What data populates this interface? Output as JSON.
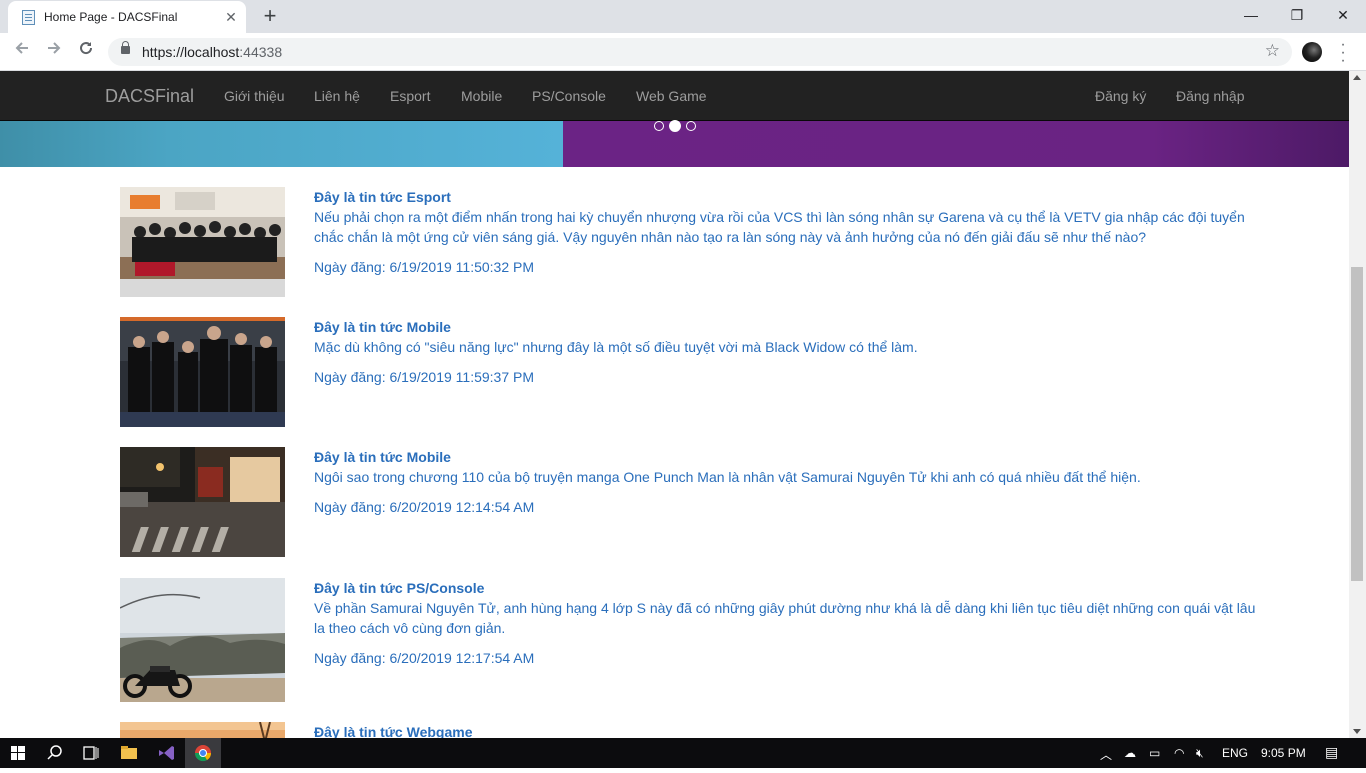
{
  "browser": {
    "tab_title": "Home Page - DACSFinal",
    "tab_close": "✕",
    "new_tab": "+",
    "url_host": "https://localhost",
    "url_port": ":44338",
    "window_min": "—",
    "window_restore": "❐",
    "window_close": "✕"
  },
  "site": {
    "brand": "DACSFinal",
    "nav": [
      "Giới thiệu",
      "Liên hệ",
      "Esport",
      "Mobile",
      "PS/Console",
      "Web Game"
    ],
    "nav_right": [
      "Đăng ký",
      "Đăng nhập"
    ]
  },
  "carousel": {
    "active_index": 1,
    "count": 3,
    "colors": {
      "left": "#55b2d8",
      "right": "#6a2383"
    }
  },
  "news": [
    {
      "title": "Đây là tin tức Esport",
      "desc": "Nếu phải chọn ra một điểm nhấn trong hai kỳ chuyển nhượng vừa rồi của VCS thì làn sóng nhân sự Garena và cụ thể là VETV gia nhập các đội tuyển chắc chắn là một ứng cử viên sáng giá. Vậy nguyên nhân nào tạo ra làn sóng này và ảnh hưởng của nó đến giải đấu sẽ như thế nào?",
      "date": "Ngày đăng: 6/19/2019 11:50:32 PM"
    },
    {
      "title": "Đây là tin tức Mobile",
      "desc": "Mặc dù không có \"siêu năng lực\" nhưng đây là một số điều tuyệt vời mà Black Widow có thể làm.",
      "date": "Ngày đăng: 6/19/2019 11:59:37 PM"
    },
    {
      "title": "Đây là tin tức Mobile",
      "desc": "Ngôi sao trong chương 110 của bộ truyện manga One Punch Man là nhân vật Samurai Nguyên Tử khi anh có quá nhiều đất thể hiện.",
      "date": "Ngày đăng: 6/20/2019 12:14:54 AM"
    },
    {
      "title": "Đây là tin tức PS/Console",
      "desc": "Về phần Samurai Nguyên Tử, anh hùng hạng 4 lớp S này đã có những giây phút dường như khá là dễ dàng khi liên tục tiêu diệt những con quái vật lâu la theo cách vô cùng đơn giản.",
      "date": "Ngày đăng: 6/20/2019 12:17:54 AM"
    },
    {
      "title": "Đây là tin tức Webgame",
      "desc": "",
      "date": ""
    }
  ],
  "taskbar": {
    "language": "ENG",
    "time": "9:05 PM"
  }
}
